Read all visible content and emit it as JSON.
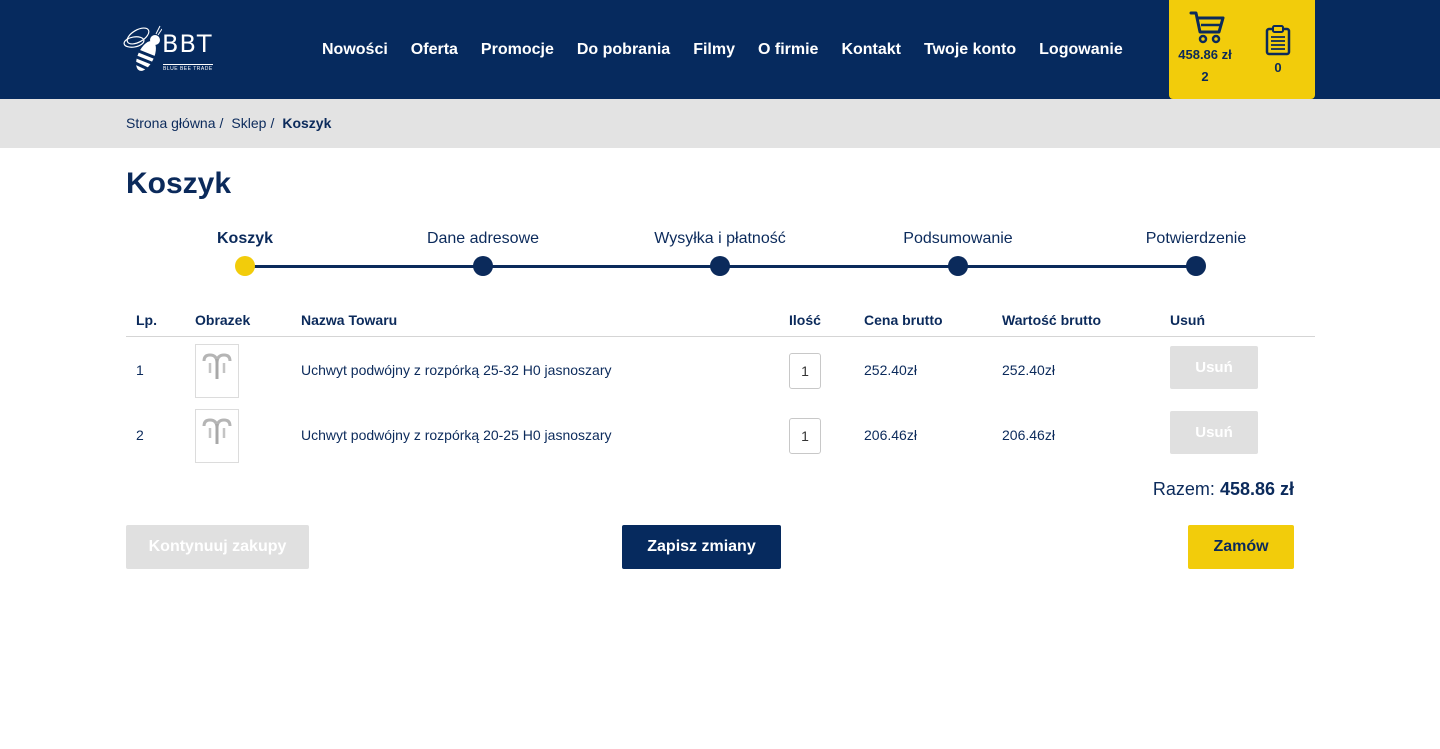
{
  "header": {
    "logo": {
      "text": "BBT",
      "subtitle": "BLUE BEE TRADE"
    },
    "nav": [
      "Nowości",
      "Oferta",
      "Promocje",
      "Do pobrania",
      "Filmy",
      "O firmie",
      "Kontakt",
      "Twoje konto",
      "Logowanie"
    ],
    "cart": {
      "total": "458.86 zł",
      "count": "2",
      "icon": "shopping-cart-icon"
    },
    "clipboard": {
      "count": "0",
      "icon": "clipboard-icon"
    }
  },
  "breadcrumb": {
    "items": [
      "Strona główna",
      "Sklep"
    ],
    "separator": "/",
    "current": "Koszyk"
  },
  "page": {
    "title": "Koszyk"
  },
  "steps": [
    {
      "label": "Koszyk",
      "active": true
    },
    {
      "label": "Dane adresowe",
      "active": false
    },
    {
      "label": "Wysyłka i płatność",
      "active": false
    },
    {
      "label": "Podsumowanie",
      "active": false
    },
    {
      "label": "Potwierdzenie",
      "active": false
    }
  ],
  "table": {
    "headers": [
      "Lp.",
      "Obrazek",
      "Nazwa Towaru",
      "Ilość",
      "Cena brutto",
      "Wartość brutto",
      "Usuń"
    ],
    "rows": [
      {
        "lp": "1",
        "name": "Uchwyt podwójny z rozpórką 25-32 H0 jasnoszary",
        "qty": "1",
        "price": "252.40zł",
        "value": "252.40zł",
        "remove": "Usuń"
      },
      {
        "lp": "2",
        "name": "Uchwyt podwójny z rozpórką 20-25 H0 jasnoszary",
        "qty": "1",
        "price": "206.46zł",
        "value": "206.46zł",
        "remove": "Usuń"
      }
    ]
  },
  "summary": {
    "label": "Razem:",
    "value": "458.86 zł"
  },
  "actions": {
    "continue": "Kontynuuj zakupy",
    "save": "Zapisz zmiany",
    "order": "Zamów"
  },
  "colors": {
    "navy": "#062a5e",
    "yellow": "#f2cc0b",
    "gray": "#e3e3e3",
    "disabled": "#e0e0e0"
  }
}
